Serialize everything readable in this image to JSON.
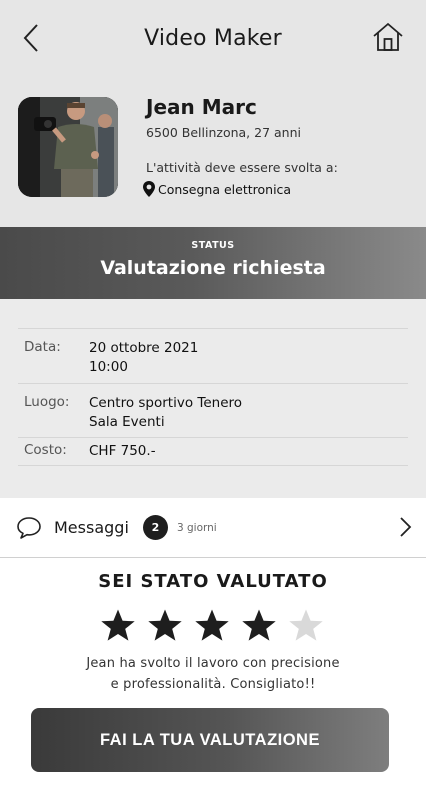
{
  "header": {
    "title": "Video Maker"
  },
  "profile": {
    "name": "Jean Marc",
    "info": "6500 Bellinzona, 27 anni",
    "task_label": "L'attività deve essere svolta a:",
    "delivery": "Consegna elettronica"
  },
  "status": {
    "label": "STATUS",
    "value": "Valutazione richiesta"
  },
  "details": {
    "rows": [
      {
        "key": "Data:",
        "line1": "20 ottobre 2021",
        "line2": "10:00"
      },
      {
        "key": "Luogo:",
        "line1": "Centro sportivo Tenero",
        "line2": "Sala Eventi"
      },
      {
        "key": "Costo:",
        "line1": "CHF 750.-"
      }
    ]
  },
  "messages": {
    "label": "Messaggi",
    "count": "2",
    "time": "3 giorni"
  },
  "rating": {
    "title": "SEI STATO VALUTATO",
    "stars": 4,
    "max_stars": 5,
    "comment_line1": "Jean ha svolto il lavoro con precisione",
    "comment_line2": "e professionalità. Consigliato!!",
    "cta_label": "FAI LA TUA VALUTAZIONE"
  },
  "colors": {
    "star_filled": "#1e1e1e",
    "star_empty": "#d9d9d9"
  }
}
